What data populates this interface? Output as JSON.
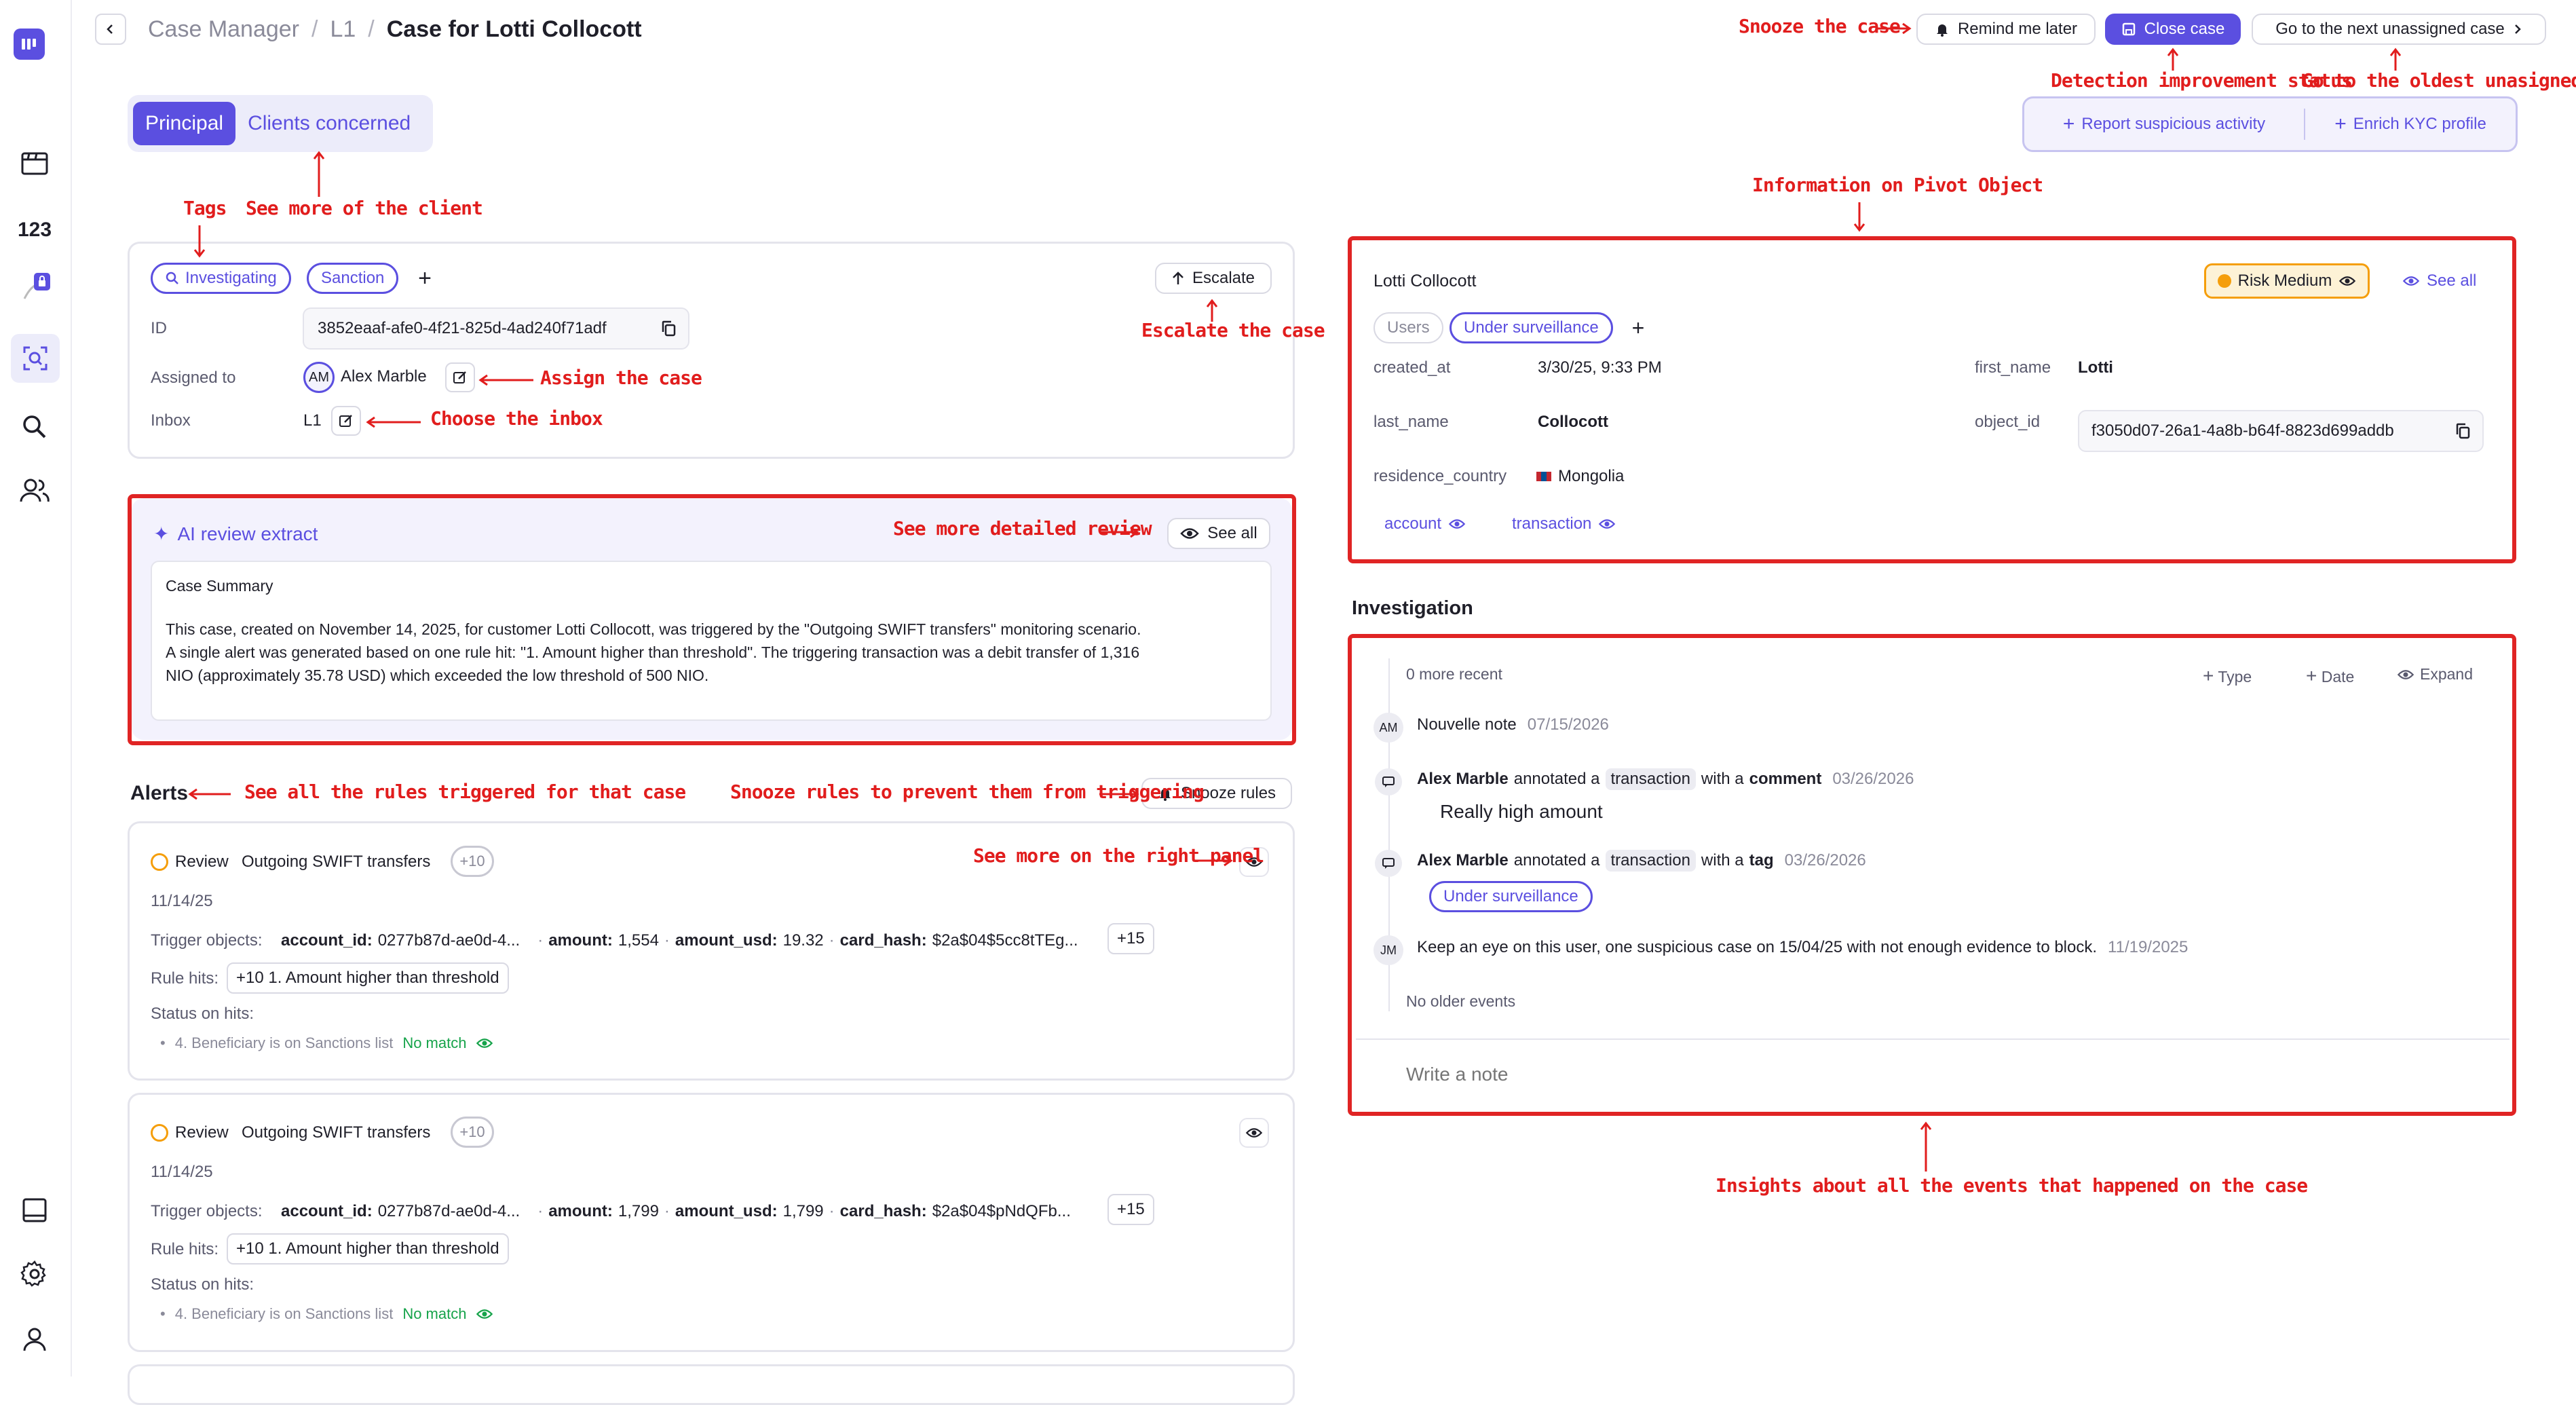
{
  "header": {
    "breadcrumb": [
      "Case Manager",
      "L1",
      "Case for Lotti Collocott"
    ],
    "remind_label": "Remind me later",
    "close_label": "Close case",
    "next_label": "Go to the next unassigned case",
    "report_label": "Report suspicious activity",
    "enrich_label": "Enrich KYC profile"
  },
  "tabs": {
    "principal": "Principal",
    "clients": "Clients concerned"
  },
  "case": {
    "tags": [
      "Investigating",
      "Sanction"
    ],
    "escalate_label": "Escalate",
    "id_label": "ID",
    "id_value": "3852eaaf-afe0-4f21-825d-4ad240f71adf",
    "assigned_label": "Assigned to",
    "assignee_initials": "AM",
    "assignee": "Alex Marble",
    "inbox_label": "Inbox",
    "inbox_value": "L1"
  },
  "ai": {
    "title": "AI review extract",
    "see_all": "See all",
    "summary_heading": "Case Summary",
    "summary_line1": "This case, created on November 14, 2025, for customer Lotti Collocott, was triggered by the \"Outgoing SWIFT transfers\" monitoring scenario.",
    "summary_line2": "A single alert was generated based on one rule hit: \"1. Amount higher than threshold\". The triggering transaction was a debit transfer of 1,316",
    "summary_line3": "NIO (approximately 35.78 USD) which exceeded the low threshold of 500 NIO."
  },
  "alerts": {
    "title": "Alerts",
    "snooze_label": "Snooze rules",
    "items": [
      {
        "status": "Review",
        "scenario": "Outgoing SWIFT transfers",
        "count": "+10",
        "date": "11/14/25",
        "trigger_label": "Trigger objects:",
        "account_key": "account_id:",
        "account_val": "0277b87d-ae0d-4...",
        "amount_key": "amount:",
        "amount_val": "1,554",
        "amount_usd_key": "amount_usd:",
        "amount_usd_val": "19.32",
        "card_key": "card_hash:",
        "card_val": "$2a$04$5cc8tTEg...",
        "more": "+15",
        "rule_label": "Rule hits:",
        "rule_val": "+10 1. Amount higher than threshold",
        "status_label": "Status on hits:",
        "hit": "4. Beneficiary is on Sanctions list",
        "hit_status": "No match"
      },
      {
        "status": "Review",
        "scenario": "Outgoing SWIFT transfers",
        "count": "+10",
        "date": "11/14/25",
        "trigger_label": "Trigger objects:",
        "account_key": "account_id:",
        "account_val": "0277b87d-ae0d-4...",
        "amount_key": "amount:",
        "amount_val": "1,799",
        "amount_usd_key": "amount_usd:",
        "amount_usd_val": "1,799",
        "card_key": "card_hash:",
        "card_val": "$2a$04$pNdQFb...",
        "more": "+15",
        "rule_label": "Rule hits:",
        "rule_val": "+10 1. Amount higher than threshold",
        "status_label": "Status on hits:",
        "hit": "4. Beneficiary is on Sanctions list",
        "hit_status": "No match"
      }
    ]
  },
  "pivot": {
    "name": "Lotti Collocott",
    "risk": "Risk Medium",
    "see_all": "See all",
    "tags": [
      "Users",
      "Under surveillance"
    ],
    "fields": {
      "created_at_label": "created_at",
      "created_at": "3/30/25, 9:33 PM",
      "first_name_label": "first_name",
      "first_name": "Lotti",
      "last_name_label": "last_name",
      "last_name": "Collocott",
      "object_id_label": "object_id",
      "object_id": "f3050d07-26a1-4a8b-b64f-8823d699addb",
      "country_label": "residence_country",
      "country": "Mongolia"
    },
    "links": [
      "account",
      "transaction"
    ]
  },
  "investigation": {
    "title": "Investigation",
    "more_recent": "0 more recent",
    "type": "Type",
    "date": "Date",
    "expand": "Expand",
    "ev1_initials": "AM",
    "ev1_text": "Nouvelle note",
    "ev1_date": "07/15/2026",
    "ev2_user": "Alex Marble",
    "ev2_mid": "annotated a",
    "ev2_obj": "transaction",
    "ev2_with": "with a",
    "ev2_kind": "comment",
    "ev2_date": "03/26/2026",
    "ev2_comment": "Really high amount",
    "ev3_user": "Alex Marble",
    "ev3_mid": "annotated a",
    "ev3_obj": "transaction",
    "ev3_with": "with a",
    "ev3_kind": "tag",
    "ev3_date": "03/26/2026",
    "ev3_tag": "Under surveillance",
    "ev4_initials": "JM",
    "ev4_text": "Keep an eye on this user, one suspicious case on 15/04/25 with not enough evidence to block.",
    "ev4_date": "11/19/2025",
    "no_older": "No older events",
    "note_placeholder": "Write a note"
  },
  "annotations": {
    "snooze_case": "Snooze the case",
    "detection": "Detection improvement status",
    "oldest": "Go to the oldest unasigned case",
    "pivot_info": "Information on Pivot Object",
    "tags": "Tags",
    "see_client": "See more of the client",
    "escalate": "Escalate the case",
    "assign": "Assign the case",
    "inbox": "Choose the inbox",
    "review": "See more detailed review",
    "rules": "See all the rules triggered for that case",
    "snooze_rules": "Snooze rules to prevent them from triggering",
    "right_panel": "See more on the right panel",
    "insights": "Insights about all the events that happened on the case"
  },
  "colors": {
    "accent": "#5b4fe0",
    "annotation": "#e11d1d",
    "risk": "#f59e0b"
  }
}
